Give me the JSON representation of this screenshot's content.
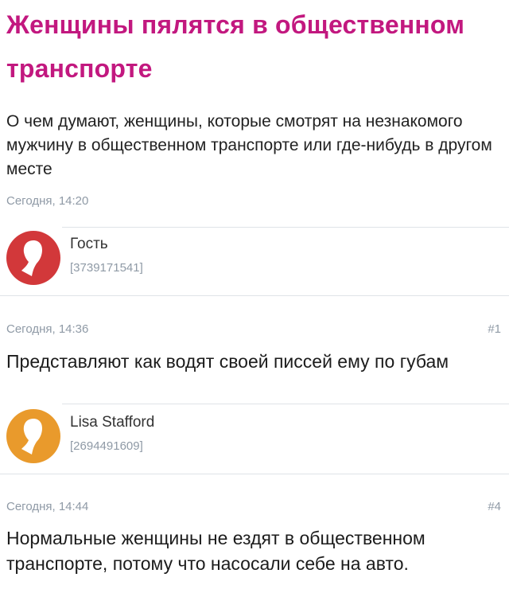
{
  "post": {
    "title": "Женщины пялятся в общественном транспорте",
    "description": "О чем думают, женщины, которые смотрят на незнакомого мужчину в общественном транспорте или где-нибудь в другом месте",
    "date": "Сегодня, 14:20"
  },
  "colors": {
    "title": "#c2187f",
    "meta_text": "#8f9aa6",
    "avatar_red": "#d2383a",
    "avatar_orange": "#e99a2c",
    "divider": "#dfe3e8"
  },
  "comments": [
    {
      "author": "Гость",
      "author_id": "[3739171541]",
      "avatar_icon": "user-silhouette-icon",
      "date": "Сегодня, 14:36",
      "number": "#1",
      "text": "Представляют как водят своей писсей ему по губам"
    },
    {
      "author": "Lisa Stafford",
      "author_id": "[2694491609]",
      "avatar_icon": "user-silhouette-icon",
      "date": "Сегодня, 14:44",
      "number": "#4",
      "text": "Нормальные женщины не ездят в общественном транспорте, потому что насосали себе на авто."
    }
  ]
}
